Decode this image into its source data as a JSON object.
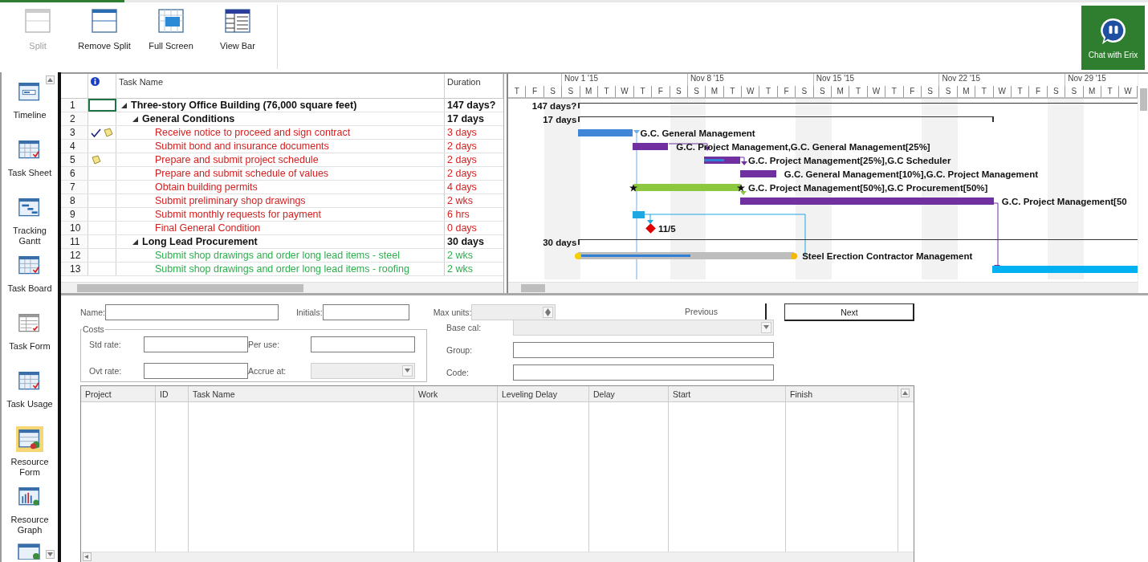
{
  "ribbon": {
    "buttons": [
      {
        "label": "Split",
        "disabled": true
      },
      {
        "label": "Remove Split",
        "disabled": false
      },
      {
        "label": "Full Screen",
        "disabled": false
      },
      {
        "label": "View Bar",
        "disabled": false
      }
    ],
    "chat_button": {
      "label": "Chat with Erix"
    }
  },
  "view_bar": {
    "items": [
      {
        "label": "Timeline",
        "selected": false
      },
      {
        "label": "Task Sheet",
        "selected": false
      },
      {
        "label": "Tracking Gantt",
        "selected": false
      },
      {
        "label": "Task Board",
        "selected": false
      },
      {
        "label": "Task Form",
        "selected": false
      },
      {
        "label": "Task Usage",
        "selected": false
      },
      {
        "label": "Resource Form",
        "selected": true
      },
      {
        "label": "Resource Graph",
        "selected": false
      }
    ]
  },
  "task_table": {
    "columns": [
      "Task Name",
      "Duration"
    ],
    "tasks": [
      {
        "id": "1",
        "name": "Three-story Office Building (76,000 square feet)",
        "duration": "147 days?",
        "kind": "summary",
        "selected": true,
        "complete": false,
        "note": false,
        "expanded": true,
        "bar_label": "147 days?",
        "children": [
          {
            "id": "2",
            "name": "General Conditions",
            "duration": "17 days",
            "kind": "summary",
            "selected": false,
            "complete": false,
            "note": false,
            "expanded": true,
            "bar_label": "17 days",
            "children": [
              {
                "id": "3",
                "name": "Receive notice to proceed and sign contract",
                "duration": "3 days",
                "kind": "task",
                "critical": true,
                "selected": false,
                "complete": true,
                "note": true,
                "color": "#3f86d6",
                "bar_label": "G.C. General Management"
              },
              {
                "id": "4",
                "name": "Submit bond and insurance documents",
                "duration": "2 days",
                "kind": "task",
                "critical": true,
                "selected": false,
                "complete": false,
                "note": false,
                "color": "#7030a0",
                "bar_label": "G.C. Project Management,G.C. General Management[25%]"
              },
              {
                "id": "5",
                "name": "Prepare and submit project schedule",
                "duration": "2 days",
                "kind": "task",
                "critical": true,
                "selected": false,
                "complete": false,
                "note": true,
                "color": "#7030a0",
                "level": 0.55,
                "bar_label": "G.C. Project Management[25%],G.C Scheduler"
              },
              {
                "id": "6",
                "name": "Prepare and submit schedule of values",
                "duration": "2 days",
                "kind": "task",
                "critical": true,
                "selected": false,
                "complete": false,
                "note": false,
                "color": "#7030a0",
                "bar_label": "G.C. General Management[10%],G.C. Project Management"
              },
              {
                "id": "7",
                "name": "Obtain building permits",
                "duration": "4 days",
                "kind": "task",
                "critical": true,
                "selected": false,
                "complete": false,
                "note": false,
                "color": "#8dc63f",
                "bar_label": "G.C. Project Management[50%],G.C Procurement[50%]"
              },
              {
                "id": "8",
                "name": "Submit preliminary shop drawings",
                "duration": "2 wks",
                "kind": "task",
                "critical": true,
                "selected": false,
                "complete": false,
                "note": false,
                "color": "#7030a0",
                "bar_label": "G.C. Project Management[50"
              },
              {
                "id": "9",
                "name": "Submit monthly requests for payment",
                "duration": "6 hrs",
                "kind": "task",
                "critical": true,
                "selected": false,
                "complete": false,
                "note": false,
                "color": "#1ea7e1"
              },
              {
                "id": "10",
                "name": "Final General Condition",
                "duration": "0 days",
                "kind": "milestone",
                "critical": true,
                "selected": false,
                "complete": false,
                "note": false,
                "color": "#e00000",
                "bar_label": "11/5"
              }
            ]
          },
          {
            "id": "11",
            "name": "Long Lead Procurement",
            "duration": "30 days",
            "kind": "summary",
            "selected": false,
            "complete": false,
            "note": false,
            "expanded": true,
            "bar_label": "30 days",
            "children": [
              {
                "id": "12",
                "name": "Submit shop drawings and order long lead items - steel",
                "duration": "2 wks",
                "kind": "task",
                "critical": false,
                "selected": false,
                "complete": false,
                "note": false,
                "color": "#bdbdbd",
                "level": 0.52,
                "bar_label": "Steel Erection Contractor Management"
              },
              {
                "id": "13",
                "name": "Submit shop drawings and order long lead items - roofing",
                "duration": "2 wks",
                "kind": "task",
                "critical": false,
                "selected": false,
                "complete": false,
                "note": false,
                "color": "#00b0f0"
              }
            ]
          }
        ]
      }
    ]
  },
  "gantt": {
    "weeks": [
      "Nov 1 '15",
      "Nov 8 '15",
      "Nov 15 '15",
      "Nov 22 '15",
      "Nov 29 '15"
    ],
    "days": [
      "T",
      "F",
      "S",
      "S",
      "M",
      "T",
      "W",
      "T",
      "F",
      "S",
      "S",
      "M",
      "T",
      "W",
      "T",
      "F",
      "S",
      "S",
      "M",
      "T",
      "W",
      "T",
      "F",
      "S",
      "S",
      "M",
      "T",
      "W",
      "T",
      "F",
      "S",
      "S",
      "M",
      "T",
      "W"
    ]
  },
  "resource_form": {
    "name": {
      "label": "Name:",
      "disabled": false
    },
    "initials": {
      "label": "Initials:",
      "disabled": false
    },
    "max_units": {
      "label": "Max units:",
      "disabled": true
    },
    "buttons": [
      {
        "label": "Previous",
        "kind": "flat"
      },
      {
        "label": "Next",
        "kind": "default"
      }
    ],
    "costs": {
      "title": "Costs",
      "std_rate": {
        "label": "Std rate:",
        "disabled": false
      },
      "per_use": {
        "label": "Per use:",
        "disabled": false
      },
      "ovt_rate": {
        "label": "Ovt rate:",
        "disabled": false
      },
      "accrue_at": {
        "label": "Accrue at:",
        "disabled": true
      }
    },
    "base_cal": {
      "label": "Base cal:",
      "disabled": true
    },
    "group": {
      "label": "Group:",
      "disabled": false
    },
    "code": {
      "label": "Code:",
      "disabled": false
    },
    "table": {
      "columns": [
        "Project",
        "ID",
        "Task Name",
        "Work",
        "Leveling Delay",
        "Delay",
        "Start",
        "Finish"
      ]
    }
  }
}
